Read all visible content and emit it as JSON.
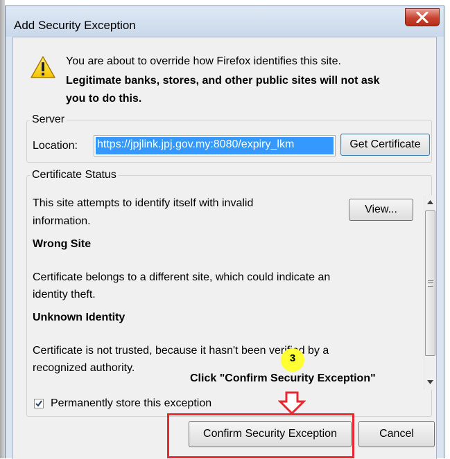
{
  "window": {
    "title": "Add Security Exception",
    "close_symbol": "X"
  },
  "warning": {
    "icon": "warning-icon",
    "line1": "You are about to override how Firefox identifies this site.",
    "line2": "Legitimate banks, stores, and other public sites will not ask",
    "line3": "you to do this."
  },
  "server": {
    "legend": "Server",
    "location_label": "Location:",
    "location_value": "https://jpjlink.jpj.gov.my:8080/expiry_lkm",
    "get_certificate_label": "Get Certificate"
  },
  "certificate_status": {
    "legend": "Certificate Status",
    "view_label": "View...",
    "intro_line1": "This site attempts to identify itself with invalid",
    "intro_line2": "information.",
    "wrong_site_heading": "Wrong Site",
    "wrong_site_line1": "Certificate belongs to a different site, which could indicate an",
    "wrong_site_line2": "identity theft.",
    "unknown_identity_heading": "Unknown Identity",
    "unknown_line1": "Certificate is not trusted, because it hasn't been verified by a",
    "unknown_line2": "recognized authority."
  },
  "permanent_store": {
    "label": "Permanently store this exception",
    "checked": true
  },
  "buttons": {
    "confirm_label": "Confirm Security Exception",
    "cancel_label": "Cancel"
  },
  "annotation": {
    "step_number": "3",
    "instruction": "Click \"Confirm Security Exception\"",
    "highlight_color": "#e8272f",
    "badge_color": "#ffff33"
  }
}
